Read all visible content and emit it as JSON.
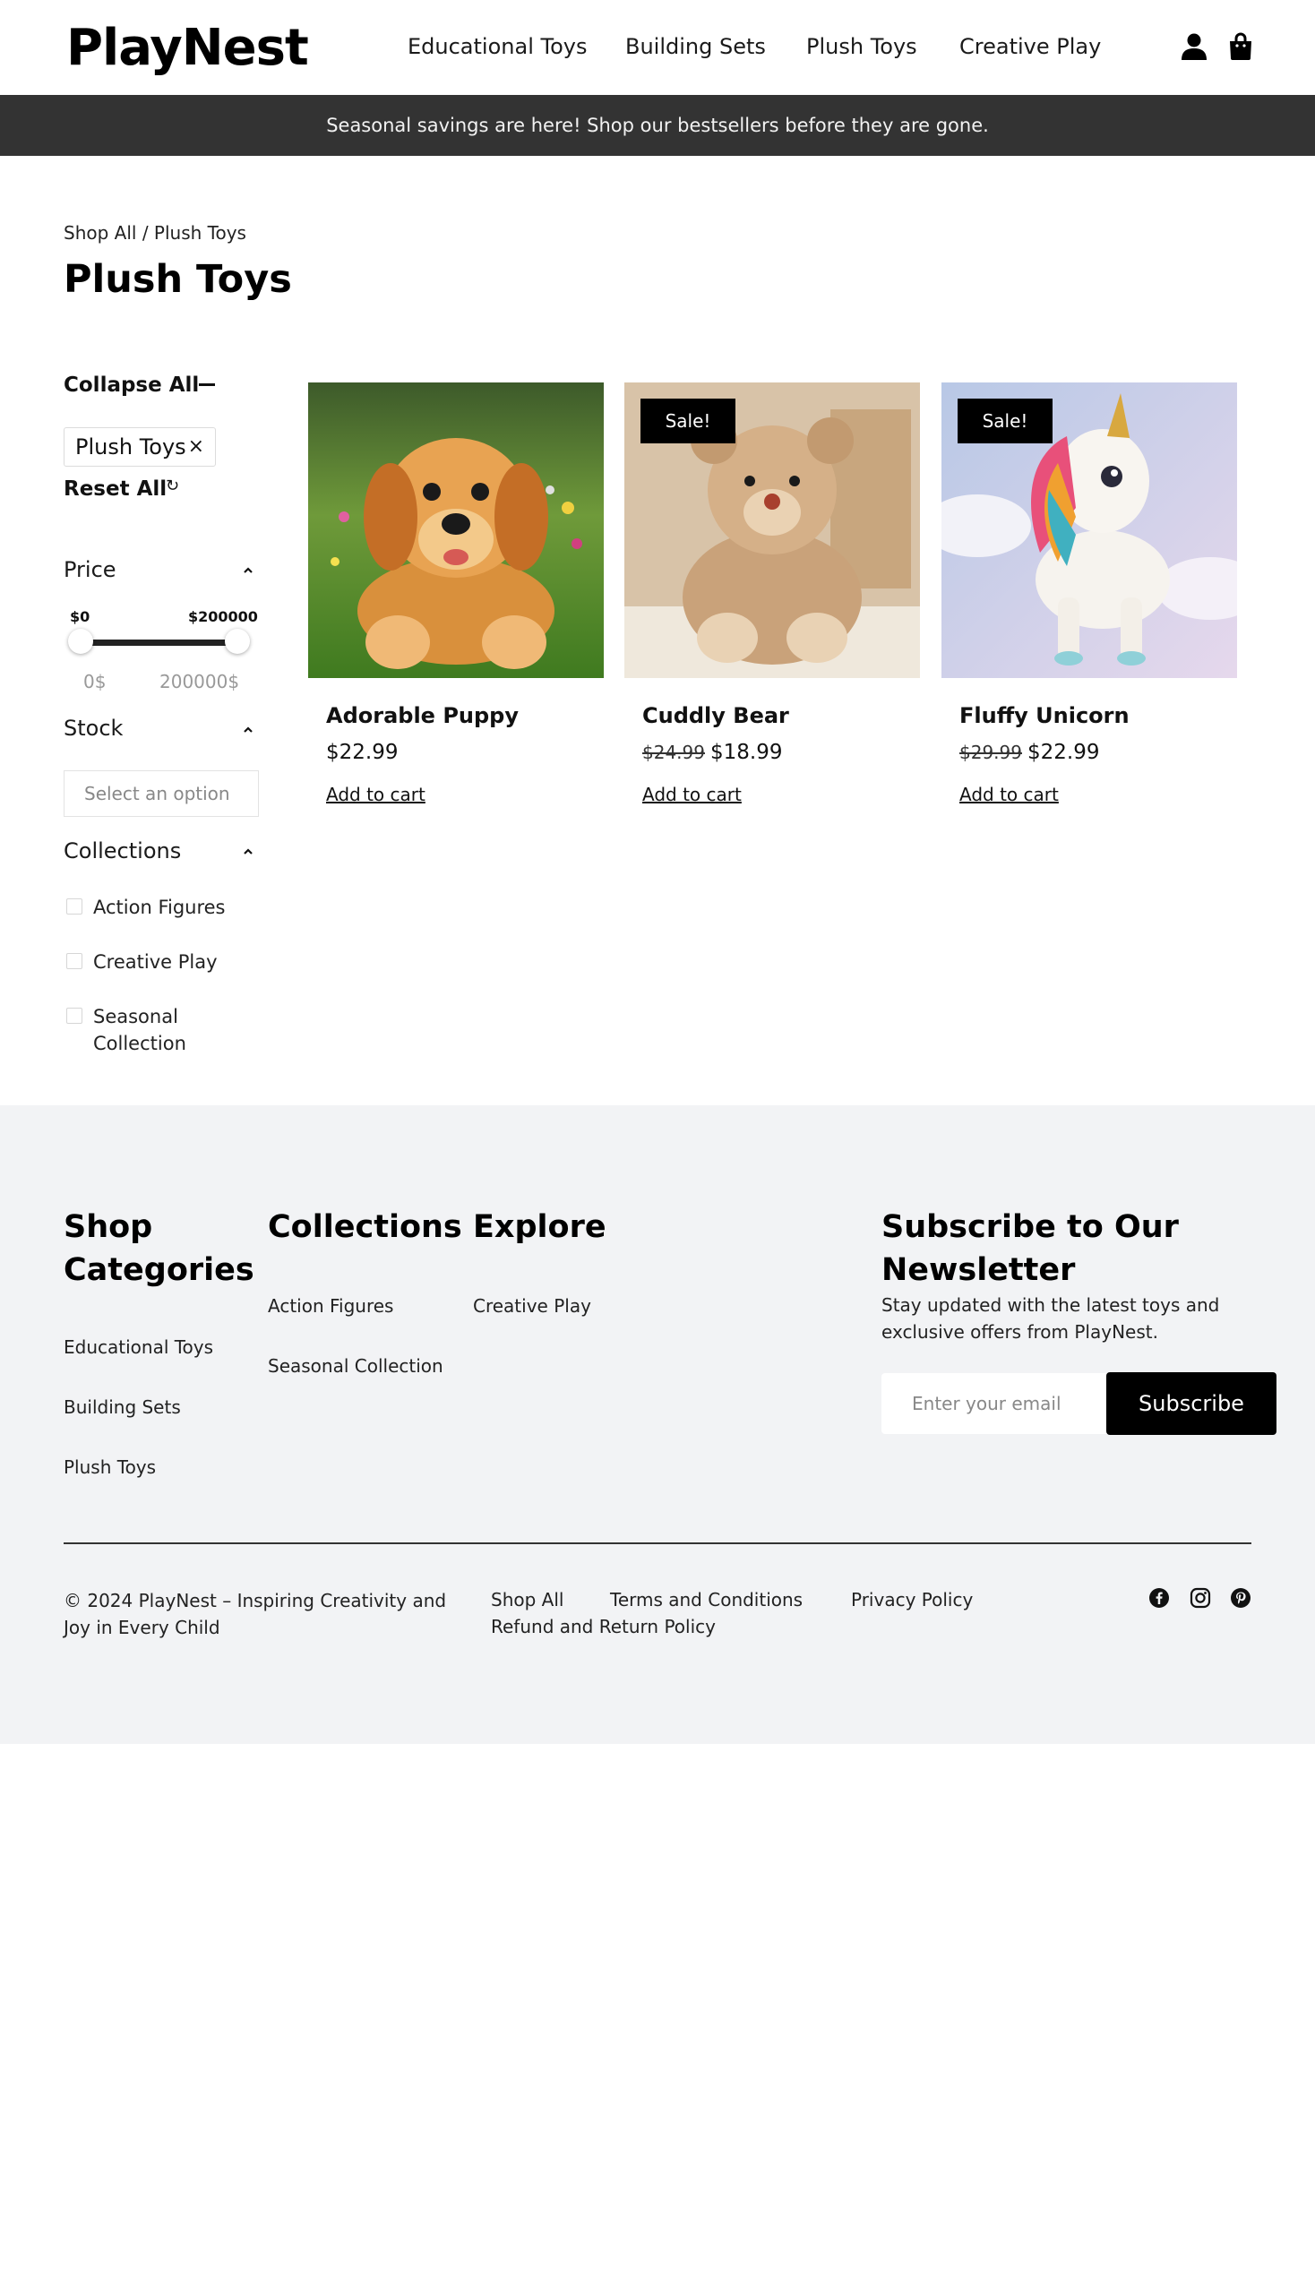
{
  "header": {
    "logo": "PlayNest",
    "nav": [
      "Educational Toys",
      "Building Sets",
      "Plush Toys",
      "Creative Play"
    ],
    "account_icon": "user-icon",
    "cart_icon": "shopping-bag-icon"
  },
  "announcement": "Seasonal savings are here! Shop our bestsellers before they are gone.",
  "breadcrumb": "Shop All / Plush Toys",
  "page_title": "Plush Toys",
  "sidebar": {
    "collapse_all": "Collapse All",
    "active_filter": "Plush Toys",
    "active_filter_remove": "×",
    "reset_all": "Reset All",
    "reset_icon": "↻",
    "price": {
      "label": "Price",
      "min_label": "$0",
      "max_label": "$200000",
      "min_unit": "0$",
      "max_unit": "200000$",
      "min_value": 0,
      "max_value": 200000
    },
    "stock": {
      "label": "Stock",
      "placeholder": "Select an option"
    },
    "collections": {
      "label": "Collections",
      "items": [
        "Action Figures",
        "Creative Play",
        "Seasonal",
        "Collection"
      ]
    }
  },
  "products": [
    {
      "name": "Adorable Puppy",
      "old_price": "",
      "price": "$22.99",
      "sale": "",
      "action": "Add to cart"
    },
    {
      "name": "Cuddly Bear",
      "old_price": "$24.99",
      "price": "$18.99",
      "sale": "Sale!",
      "action": "Add to cart"
    },
    {
      "name": "Fluffy Unicorn",
      "old_price": "$29.99",
      "price": "$22.99",
      "sale": "Sale!",
      "action": "Add to cart"
    }
  ],
  "footer": {
    "shop_categories": {
      "title_line1": "Shop",
      "title_line2": "Categories",
      "links": [
        "Educational Toys",
        "Building Sets",
        "Plush Toys"
      ]
    },
    "collections": {
      "title": "Collections",
      "links": [
        "Action Figures",
        "Seasonal Collection"
      ]
    },
    "explore": {
      "title": "Explore",
      "links": [
        "Creative Play"
      ]
    },
    "newsletter": {
      "title_line1": "Subscribe to Our",
      "title_line2": "Newsletter",
      "description": "Stay updated with the latest toys and exclusive offers from PlayNest.",
      "placeholder": "Enter your email",
      "button": "Subscribe"
    },
    "copyright": "© 2024 PlayNest – Inspiring Creativity and Joy in Every Child",
    "bottom_links": [
      "Shop All",
      "Terms and Conditions",
      "Privacy Policy",
      "Refund and Return Policy"
    ],
    "social_icons": [
      "facebook-icon",
      "instagram-icon",
      "pinterest-icon"
    ]
  }
}
